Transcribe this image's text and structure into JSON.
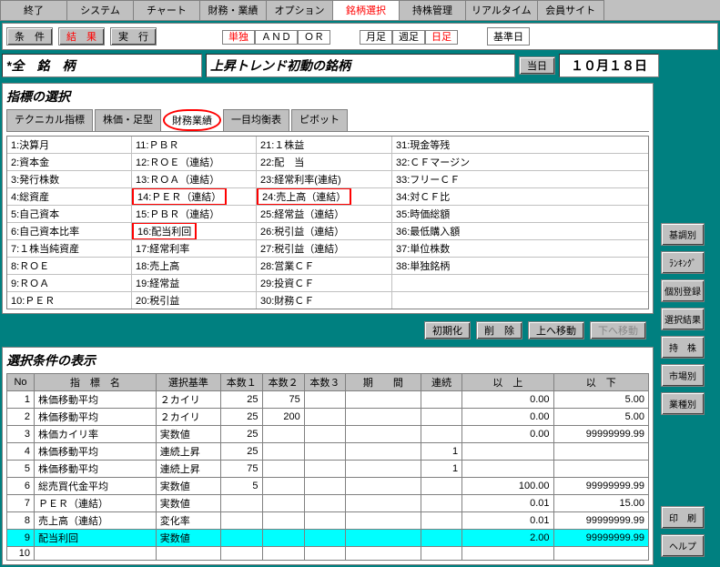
{
  "topTabs": [
    "終了",
    "システム",
    "チャート",
    "財務・業績",
    "オプション",
    "銘柄選択",
    "持株管理",
    "リアルタイム",
    "会員サイト"
  ],
  "topActive": 5,
  "tb1": {
    "cond": "条　件",
    "result": "結　果",
    "exec": "実　行"
  },
  "tb2": [
    "単独",
    "ＡＮＤ",
    "ＯＲ"
  ],
  "tb3": [
    "月足",
    "週足",
    "日足"
  ],
  "stdDay": "基準日",
  "titleLeft": "*全　銘　柄",
  "titleRight": "上昇トレンド初動の銘柄",
  "today": "当日",
  "date": "１０月１８日",
  "indTitle": "指標の選択",
  "subTabs": [
    "テクニカル指標",
    "株価・足型",
    "財務業績",
    "一目均衡表",
    "ピボット"
  ],
  "subActive": 2,
  "ind": [
    [
      "1:決算月",
      "11:ＰＢＲ",
      "21:１株益",
      "31:現金等残"
    ],
    [
      "2:資本金",
      "12:ＲＯＥ（連結）",
      "22:配　当",
      "32:ＣＦマージン"
    ],
    [
      "3:発行株数",
      "13:ＲＯＡ（連結）",
      "23:経常利率(連結)",
      "33:フリーＣＦ"
    ],
    [
      "4:総資産",
      "14:ＰＥＲ（連結）",
      "24:売上高（連結）",
      "34:対ＣＦ比"
    ],
    [
      "5:自己資本",
      "15:ＰＢＲ（連結）",
      "25:経常益（連結）",
      "35:時価総額"
    ],
    [
      "6:自己資本比率",
      "16:配当利回",
      "26:税引益（連結）",
      "36:最低購入額"
    ],
    [
      "7:１株当純資産",
      "17:経常利率",
      "27:税引益（連結）",
      "37:単位株数"
    ],
    [
      "8:ＲＯＥ",
      "18:売上高",
      "28:営業ＣＦ",
      "38:単独銘柄"
    ],
    [
      "9:ＲＯＡ",
      "19:経常益",
      "29:投資ＣＦ",
      ""
    ],
    [
      "10:ＰＥＲ",
      "20:税引益",
      "30:財務ＣＦ",
      ""
    ]
  ],
  "redCells": [
    [
      3,
      1
    ],
    [
      3,
      2
    ],
    [
      5,
      1
    ]
  ],
  "btns": {
    "init": "初期化",
    "del": "削　除",
    "up": "上へ移動",
    "down": "下へ移動"
  },
  "condTitle": "選択条件の表示",
  "condHdr": [
    "No",
    "指　標　名",
    "選択基準",
    "本数１",
    "本数２",
    "本数３",
    "期　　間",
    "連続",
    "以　上",
    "以　下"
  ],
  "cond": [
    [
      "1",
      "株価移動平均",
      "２カイリ",
      "25",
      "75",
      "",
      "",
      "",
      "0.00",
      "5.00"
    ],
    [
      "2",
      "株価移動平均",
      "２カイリ",
      "25",
      "200",
      "",
      "",
      "",
      "0.00",
      "5.00"
    ],
    [
      "3",
      "株価カイリ率",
      "実数値",
      "25",
      "",
      "",
      "",
      "",
      "0.00",
      "99999999.99"
    ],
    [
      "4",
      "株価移動平均",
      "連続上昇",
      "25",
      "",
      "",
      "",
      "1",
      "",
      ""
    ],
    [
      "5",
      "株価移動平均",
      "連続上昇",
      "75",
      "",
      "",
      "",
      "1",
      "",
      ""
    ],
    [
      "6",
      "総売買代金平均",
      "実数値",
      "5",
      "",
      "",
      "",
      "",
      "100.00",
      "99999999.99"
    ],
    [
      "7",
      "ＰＥＲ（連結）",
      "実数値",
      "",
      "",
      "",
      "",
      "",
      "0.01",
      "15.00"
    ],
    [
      "8",
      "売上高（連結）",
      "変化率",
      "",
      "",
      "",
      "",
      "",
      "0.01",
      "99999999.99"
    ],
    [
      "9",
      "配当利回",
      "実数値",
      "",
      "",
      "",
      "",
      "",
      "2.00",
      "99999999.99"
    ],
    [
      "10",
      "",
      "",
      "",
      "",
      "",
      "",
      "",
      "",
      ""
    ]
  ],
  "hlRow": 8,
  "right": [
    "基調別",
    "ﾗﾝｷﾝｸﾞ",
    "個別登録",
    "選択結果",
    "持　株",
    "市場別",
    "業種別",
    "印　刷",
    "ヘルプ"
  ]
}
